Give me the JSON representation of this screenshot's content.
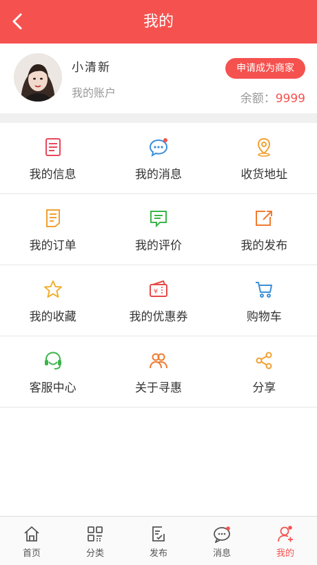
{
  "header": {
    "title": "我的",
    "back_icon": "chevron-left-icon"
  },
  "profile": {
    "name": "小清新",
    "account_link": "我的账户",
    "merchant_button": "申请成为商家",
    "balance_label": "余额：",
    "balance_value": "9999"
  },
  "grid": [
    [
      {
        "label": "我的信息",
        "icon": "document-icon"
      },
      {
        "label": "我的消息",
        "icon": "chat-bubble-icon"
      },
      {
        "label": "收货地址",
        "icon": "location-pin-icon"
      }
    ],
    [
      {
        "label": "我的订单",
        "icon": "order-icon"
      },
      {
        "label": "我的评价",
        "icon": "comment-icon"
      },
      {
        "label": "我的发布",
        "icon": "publish-icon"
      }
    ],
    [
      {
        "label": "我的收藏",
        "icon": "star-icon"
      },
      {
        "label": "我的优惠券",
        "icon": "coupon-icon"
      },
      {
        "label": "购物车",
        "icon": "cart-icon"
      }
    ],
    [
      {
        "label": "客服中心",
        "icon": "headset-icon"
      },
      {
        "label": "关于寻惠",
        "icon": "people-icon"
      },
      {
        "label": "分享",
        "icon": "share-icon"
      }
    ]
  ],
  "tabs": [
    {
      "label": "首页",
      "icon": "home-icon"
    },
    {
      "label": "分类",
      "icon": "category-icon"
    },
    {
      "label": "发布",
      "icon": "edit-icon"
    },
    {
      "label": "消息",
      "icon": "message-icon"
    },
    {
      "label": "我的",
      "icon": "user-icon",
      "active": true
    }
  ],
  "colors": {
    "accent": "#f5524f",
    "text": "#333333",
    "muted": "#999999"
  }
}
